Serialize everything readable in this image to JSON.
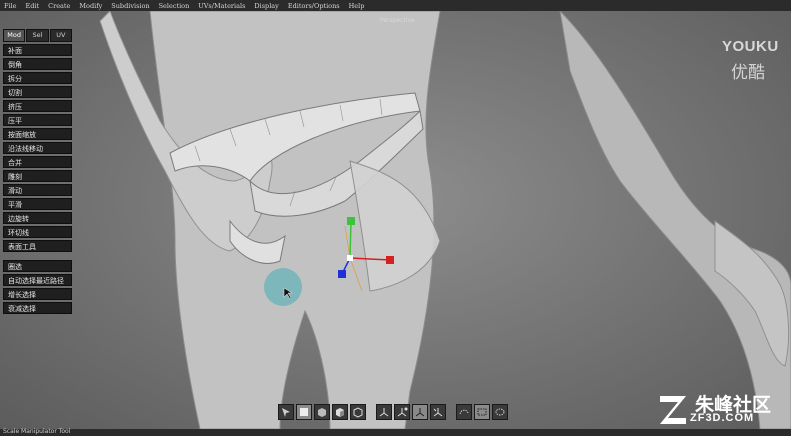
{
  "menu": [
    "File",
    "Edit",
    "Create",
    "Modify",
    "Subdivision",
    "Selection",
    "UVs/Materials",
    "Display",
    "Editors/Options",
    "Help"
  ],
  "viewport_label": "Perspective",
  "panel": {
    "tabs": [
      "Mod",
      "Sel",
      "UV"
    ],
    "group1": [
      "补面",
      "倒角",
      "拆分",
      "切割",
      "挤压",
      "压平",
      "按面缩放",
      "沿法线移动",
      "合并",
      "雕刻",
      "滑动",
      "平滑",
      "边旋转",
      "环切线",
      "表面工具"
    ],
    "group2": [
      "圈选",
      "自动选择最近路径",
      "增长选择",
      "衰减选择"
    ]
  },
  "status": "Scale Manipulator Tool",
  "watermarks": {
    "youku": "YOUKU",
    "youku_cn": "优酷",
    "zf_cn": "朱峰社区",
    "zf_en": "ZF3D.COM"
  },
  "colors": {
    "menubar": "#2b2b2b",
    "panel_btn": "#1f1f1f",
    "gizmo_x": "#d42020",
    "gizmo_y": "#3cc23c",
    "gizmo_z": "#2030d8",
    "brush": "#2aa9b4"
  }
}
